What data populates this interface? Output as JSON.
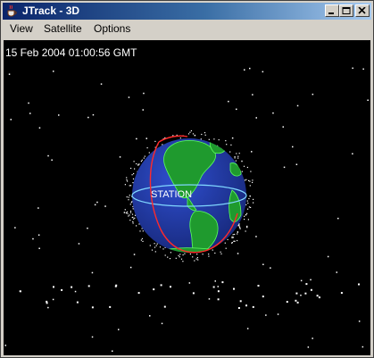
{
  "window": {
    "title": "JTrack - 3D",
    "app_icon": "java-cup-icon",
    "controls": [
      "minimize-icon",
      "maximize-icon",
      "close-icon"
    ]
  },
  "menu": {
    "items": [
      {
        "label": "View"
      },
      {
        "label": "Satellite"
      },
      {
        "label": "Options"
      }
    ]
  },
  "scene": {
    "timestamp": "15 Feb 2004 01:00:56 GMT",
    "satellite_label": "STATION",
    "colors": {
      "background": "#000000",
      "ocean": "#1e3ba8",
      "land": "#1f9a2e",
      "equator": "#7fd6ff",
      "orbit": "#ff2a2a",
      "stars": "#ffffff"
    }
  }
}
